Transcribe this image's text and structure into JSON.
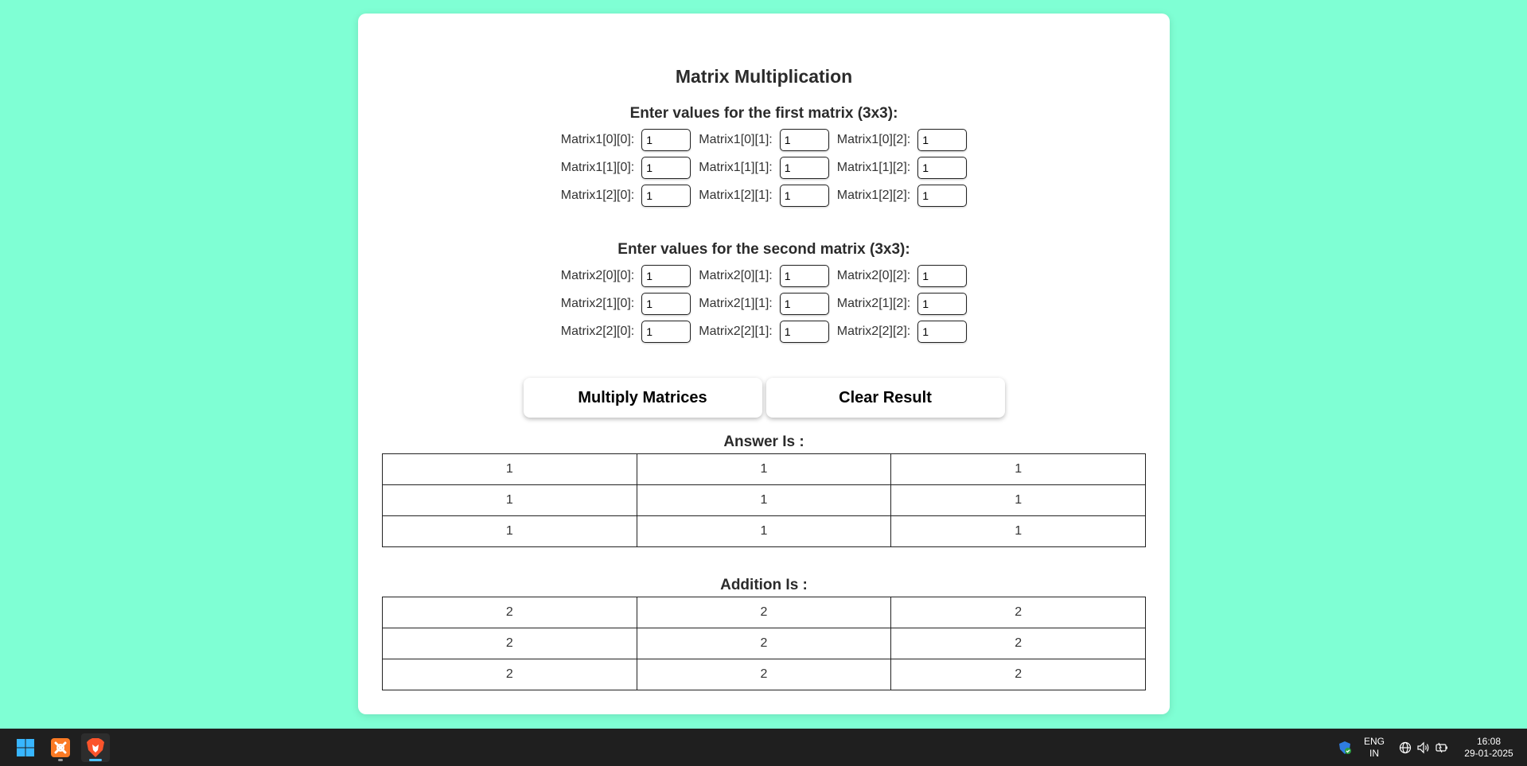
{
  "page": {
    "title": "Matrix Multiplication",
    "first_heading": "Enter values for the first matrix (3x3):",
    "second_heading": "Enter values for the second matrix (3x3):"
  },
  "matrix1": [
    [
      {
        "label": "Matrix1[0][0]:",
        "value": "1"
      },
      {
        "label": "Matrix1[0][1]:",
        "value": "1"
      },
      {
        "label": "Matrix1[0][2]:",
        "value": "1"
      }
    ],
    [
      {
        "label": "Matrix1[1][0]:",
        "value": "1"
      },
      {
        "label": "Matrix1[1][1]:",
        "value": "1"
      },
      {
        "label": "Matrix1[1][2]:",
        "value": "1"
      }
    ],
    [
      {
        "label": "Matrix1[2][0]:",
        "value": "1"
      },
      {
        "label": "Matrix1[2][1]:",
        "value": "1"
      },
      {
        "label": "Matrix1[2][2]:",
        "value": "1"
      }
    ]
  ],
  "matrix2": [
    [
      {
        "label": "Matrix2[0][0]:",
        "value": "1"
      },
      {
        "label": "Matrix2[0][1]:",
        "value": "1"
      },
      {
        "label": "Matrix2[0][2]:",
        "value": "1"
      }
    ],
    [
      {
        "label": "Matrix2[1][0]:",
        "value": "1"
      },
      {
        "label": "Matrix2[1][1]:",
        "value": "1"
      },
      {
        "label": "Matrix2[1][2]:",
        "value": "1"
      }
    ],
    [
      {
        "label": "Matrix2[2][0]:",
        "value": "1"
      },
      {
        "label": "Matrix2[2][1]:",
        "value": "1"
      },
      {
        "label": "Matrix2[2][2]:",
        "value": "1"
      }
    ]
  ],
  "buttons": {
    "multiply": "Multiply Matrices",
    "clear": "Clear Result"
  },
  "answer": {
    "heading": "Answer Is :",
    "rows": [
      [
        "1",
        "1",
        "1"
      ],
      [
        "1",
        "1",
        "1"
      ],
      [
        "1",
        "1",
        "1"
      ]
    ]
  },
  "addition": {
    "heading": "Addition Is :",
    "rows": [
      [
        "2",
        "2",
        "2"
      ],
      [
        "2",
        "2",
        "2"
      ],
      [
        "2",
        "2",
        "2"
      ]
    ]
  },
  "taskbar": {
    "lang_top": "ENG",
    "lang_bottom": "IN",
    "time": "16:08",
    "date": "29-01-2025"
  },
  "colors": {
    "background": "#7fffd4",
    "taskbar": "#1f1f1f",
    "windows_logo": "#38b6ff",
    "xampp": "#fb7a24",
    "brave": "#fb542b"
  },
  "icons": [
    "windows-start-icon",
    "xampp-icon",
    "brave-browser-icon",
    "security-shield-icon",
    "network-icon",
    "volume-icon",
    "battery-icon"
  ]
}
